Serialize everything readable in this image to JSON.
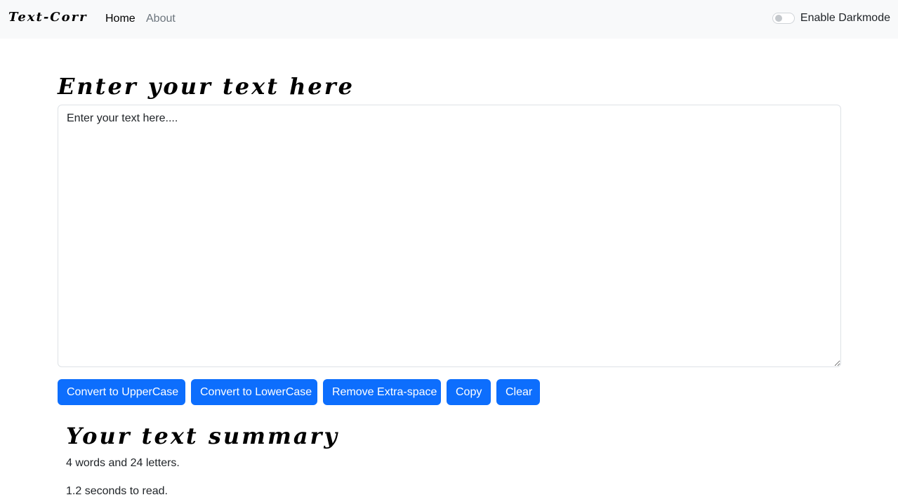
{
  "navbar": {
    "brand": "Text-Corr",
    "links": [
      "Home",
      "About"
    ],
    "darkmode_label": "Enable Darkmode",
    "darkmode_enabled": false
  },
  "main": {
    "heading": "Enter your text here",
    "textarea_value": "Enter your text here....",
    "buttons": [
      "Convert to UpperCase",
      "Convert to LowerCase",
      "Remove Extra-space",
      "Copy",
      "Clear"
    ],
    "accent_color": "#0d6efd"
  },
  "summary": {
    "heading": "Your text summary",
    "word_letter_count": "4 words and 24 letters.",
    "read_time": "1.2 seconds to read."
  }
}
